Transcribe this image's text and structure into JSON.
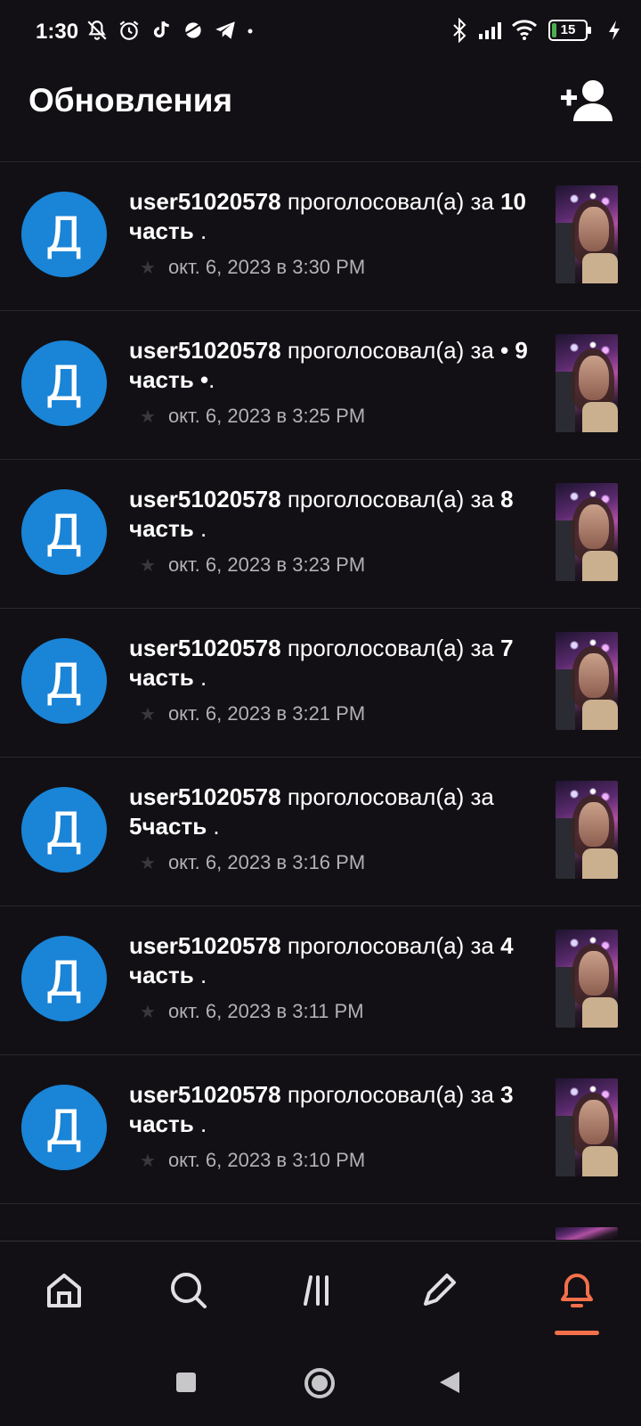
{
  "status_bar": {
    "time": "1:30",
    "battery": "15",
    "battery_level": 0.15,
    "icons_left": [
      "bell-off-icon",
      "alarm-icon",
      "tiktok-icon",
      "planet-icon",
      "telegram-icon",
      "dot-icon"
    ],
    "icons_right": [
      "bluetooth-icon",
      "signal-icon",
      "wifi-icon",
      "battery-icon",
      "charging-icon"
    ]
  },
  "header": {
    "title": "Обновления",
    "action_icon": "add-user-icon"
  },
  "notifications": [
    {
      "avatar": "Д",
      "user": "user51020578",
      "action": " проголосовал(а) за ",
      "part": "10 часть",
      "tail": " .",
      "time": "окт. 6, 2023 в 3:30 PM"
    },
    {
      "avatar": "Д",
      "user": "user51020578",
      "action": " проголосовал(а) за ",
      "part": "• 9 часть •",
      "tail": ".",
      "time": "окт. 6, 2023 в 3:25 PM"
    },
    {
      "avatar": "Д",
      "user": "user51020578",
      "action": " проголосовал(а) за ",
      "part": "8 часть",
      "tail": " .",
      "time": "окт. 6, 2023 в 3:23 PM"
    },
    {
      "avatar": "Д",
      "user": "user51020578",
      "action": " проголосовал(а) за ",
      "part": "7 часть",
      "tail": " .",
      "time": "окт. 6, 2023 в 3:21 PM"
    },
    {
      "avatar": "Д",
      "user": "user51020578",
      "action": " проголосовал(а) за ",
      "part": "5часть",
      "tail": " .",
      "time": "окт. 6, 2023 в 3:16 PM"
    },
    {
      "avatar": "Д",
      "user": "user51020578",
      "action": " проголосовал(а) за ",
      "part": "4 часть",
      "tail": " .",
      "time": "окт. 6, 2023 в 3:11 PM"
    },
    {
      "avatar": "Д",
      "user": "user51020578",
      "action": " проголосовал(а) за ",
      "part": "3 часть",
      "tail": " .",
      "time": "окт. 6, 2023 в 3:10 PM"
    }
  ],
  "bottom_nav": {
    "items": [
      "home-icon",
      "search-icon",
      "library-icon",
      "write-icon",
      "notifications-icon"
    ],
    "active": "notifications-icon",
    "accent": "#f2704b"
  },
  "colors": {
    "background": "#121014",
    "avatar": "#1a84d7",
    "meta_text": "#b3b0b6"
  }
}
